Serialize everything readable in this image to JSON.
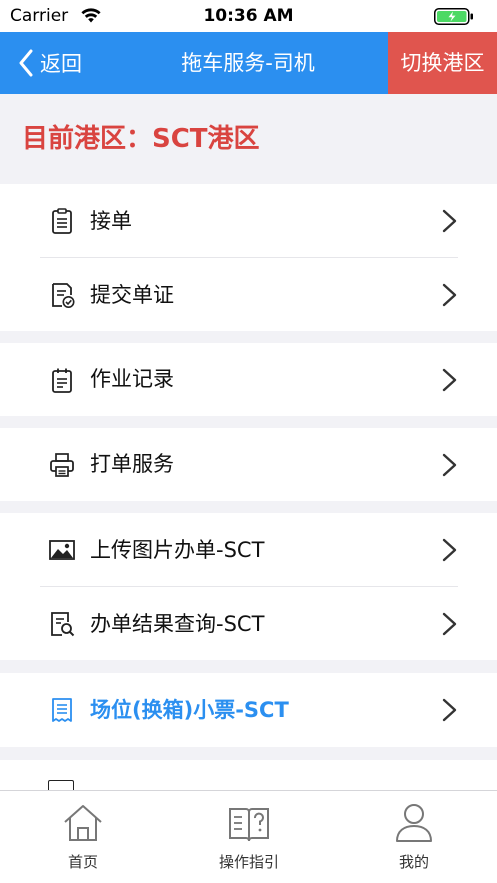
{
  "status_bar": {
    "carrier": "Carrier",
    "time": "10:36 AM"
  },
  "nav": {
    "back_label": "返回",
    "title": "拖车服务-司机",
    "switch_label": "切换港区"
  },
  "region": {
    "text": "目前港区：SCT港区"
  },
  "menu": [
    {
      "label": "接单",
      "icon": "clipboard-icon"
    },
    {
      "label": "提交单证",
      "icon": "document-check-icon"
    },
    {
      "label": "作业记录",
      "icon": "notepad-icon"
    },
    {
      "label": "打单服务",
      "icon": "printer-icon"
    },
    {
      "label": "上传图片办单-SCT",
      "icon": "image-icon"
    },
    {
      "label": "办单结果查询-SCT",
      "icon": "document-search-icon"
    },
    {
      "label": "场位(换箱)小票-SCT",
      "icon": "receipt-icon",
      "highlight_color": "#2b8ff0"
    }
  ],
  "tabs": [
    {
      "label": "首页",
      "icon": "home-icon"
    },
    {
      "label": "操作指引",
      "icon": "guide-book-icon"
    },
    {
      "label": "我的",
      "icon": "user-icon"
    }
  ],
  "colors": {
    "nav_blue": "#2b8ff0",
    "switch_red": "#e0554e",
    "region_red": "#d94440"
  }
}
